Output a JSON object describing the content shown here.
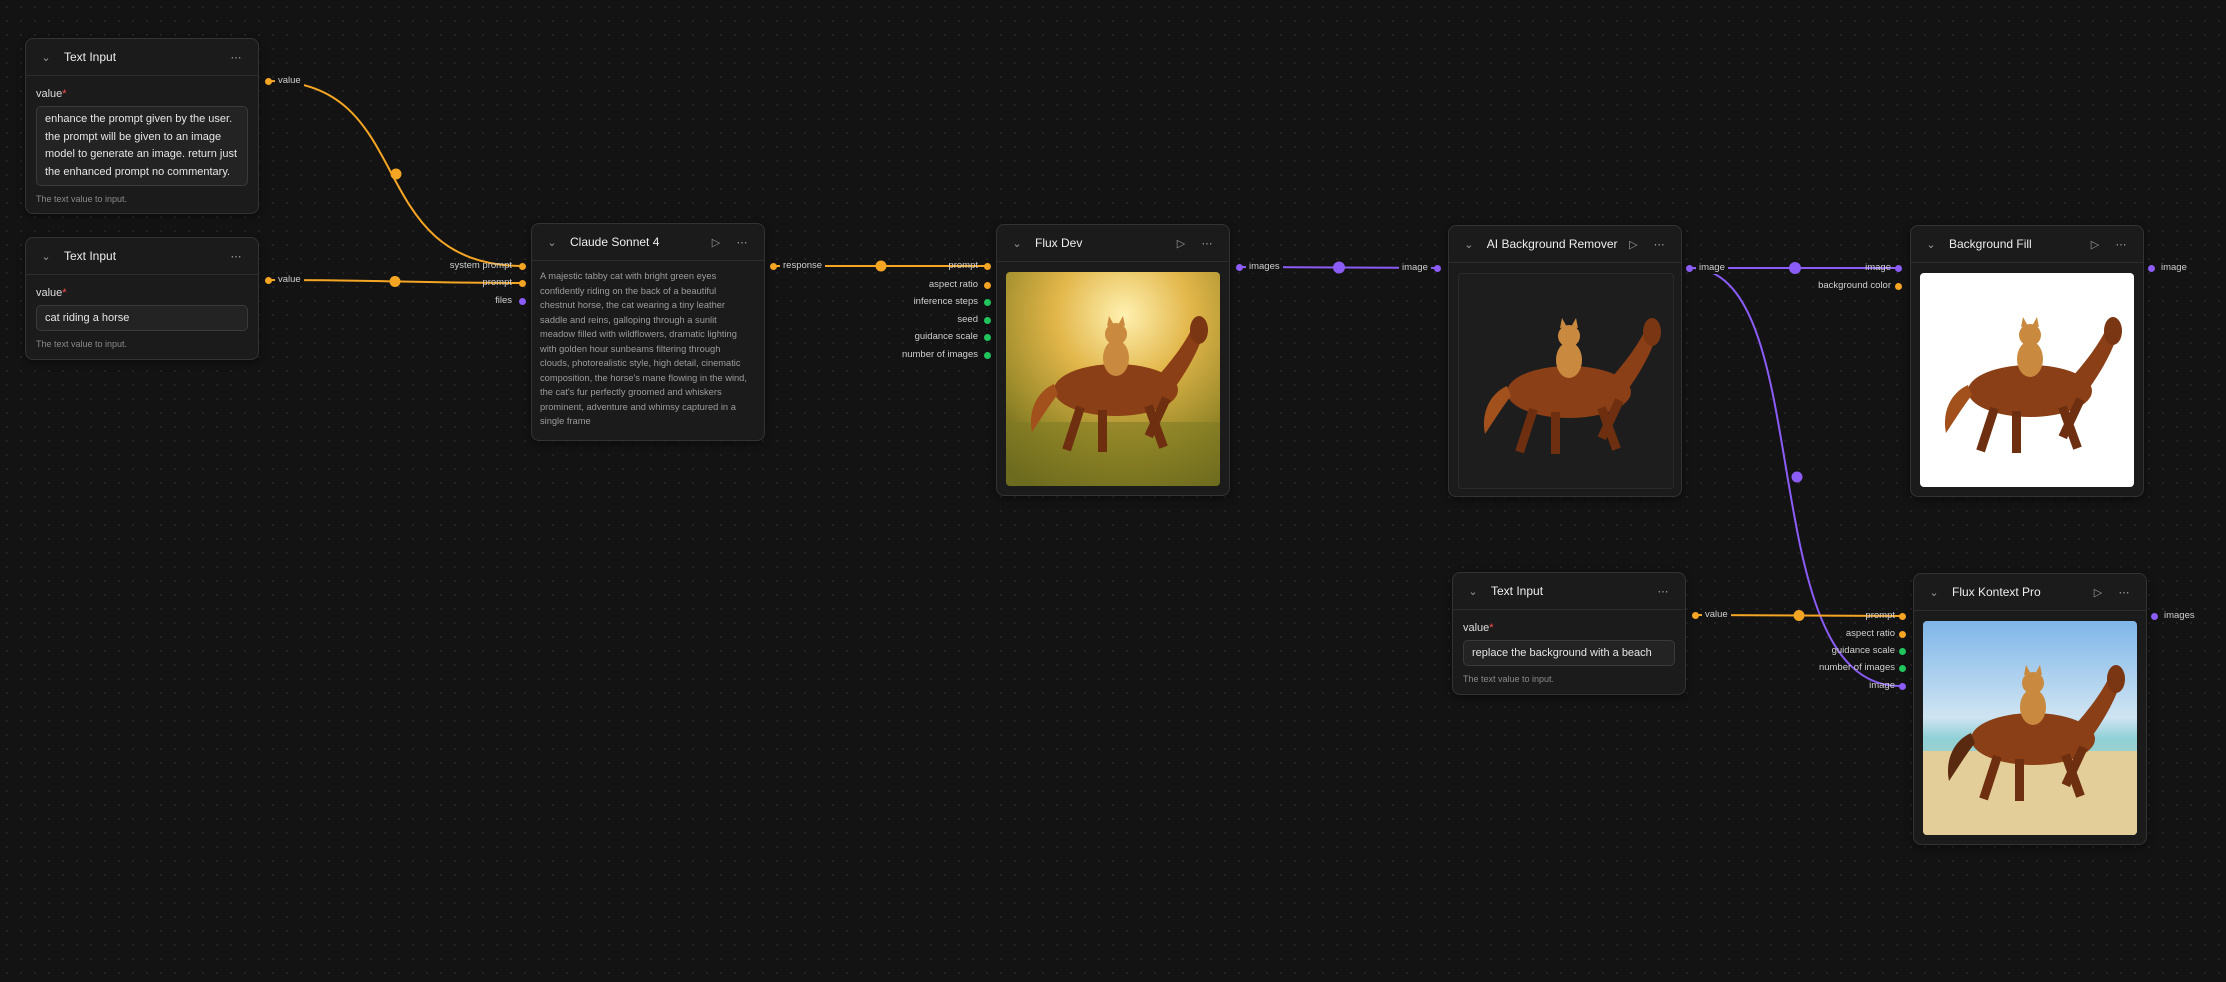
{
  "colors": {
    "string": "#f5a524",
    "image": "#8b5cf6",
    "number": "#22c55e",
    "files": "#8b5cf6"
  },
  "icons": {
    "collapse": "chevron-down-icon",
    "run": "play-icon",
    "menu": "more-horizontal-icon",
    "remove": "x-icon"
  },
  "nodes": {
    "text_input_1": {
      "title": "Text Input",
      "field_label": "value",
      "required_mark": "*",
      "value_lines": [
        "enhance the prompt given by the user.",
        "the prompt will be given to an image",
        "model to generate an image. return just",
        "the enhanced prompt no commentary."
      ],
      "hint": "The text value to input.",
      "output": "value"
    },
    "text_input_2": {
      "title": "Text Input",
      "field_label": "value",
      "required_mark": "*",
      "value": "cat riding a horse",
      "hint": "The text value to input.",
      "output": "value"
    },
    "claude": {
      "title": "Claude Sonnet 4",
      "inputs": [
        "system prompt",
        "prompt",
        "files"
      ],
      "response_lines": [
        "A majestic tabby cat with bright green eyes",
        "confidently riding on the back of a beautiful",
        "chestnut horse, the cat wearing a tiny leather",
        "saddle and reins, galloping through a sunlit",
        "meadow filled with wildflowers, dramatic lighting",
        "with golden hour sunbeams filtering through",
        "clouds, photorealistic style, high detail, cinematic",
        "composition, the horse's mane flowing in the wind,",
        "the cat's fur perfectly groomed and whiskers",
        "prominent, adventure and whimsy captured in a",
        "single frame"
      ],
      "output": "response"
    },
    "flux_dev": {
      "title": "Flux Dev",
      "inputs": [
        "prompt",
        "aspect ratio",
        "inference steps",
        "seed",
        "guidance scale",
        "number of images"
      ],
      "output": "images"
    },
    "bg_remover": {
      "title": "AI Background Remover",
      "input": "image",
      "output": "image"
    },
    "bg_fill": {
      "title": "Background Fill",
      "inputs": [
        "image",
        "background color"
      ],
      "output": "image"
    },
    "text_input_3": {
      "title": "Text Input",
      "field_label": "value",
      "required_mark": "*",
      "value": "replace the background with a beach",
      "hint": "The text value to input.",
      "output": "value"
    },
    "flux_kontext": {
      "title": "Flux Kontext Pro",
      "inputs": [
        "prompt",
        "aspect ratio",
        "guidance scale",
        "number of images",
        "image"
      ],
      "output": "images"
    }
  }
}
